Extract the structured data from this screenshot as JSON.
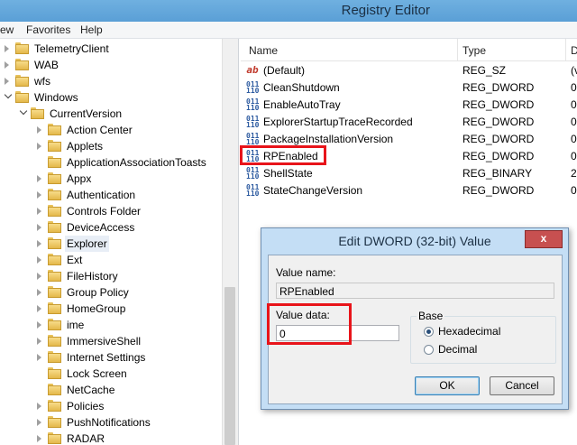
{
  "window": {
    "title": "Registry Editor"
  },
  "menu": [
    "ew",
    "Favorites",
    "Help"
  ],
  "tree": [
    {
      "label": "TelemetryClient",
      "level": 0,
      "state": "closed"
    },
    {
      "label": "WAB",
      "level": 0,
      "state": "closed"
    },
    {
      "label": "wfs",
      "level": 0,
      "state": "closed"
    },
    {
      "label": "Windows",
      "level": 0,
      "state": "open"
    },
    {
      "label": "CurrentVersion",
      "level": 1,
      "state": "open"
    },
    {
      "label": "Action Center",
      "level": 2,
      "state": "closed"
    },
    {
      "label": "Applets",
      "level": 2,
      "state": "closed"
    },
    {
      "label": "ApplicationAssociationToasts",
      "level": 2,
      "state": "none"
    },
    {
      "label": "Appx",
      "level": 2,
      "state": "closed"
    },
    {
      "label": "Authentication",
      "level": 2,
      "state": "closed"
    },
    {
      "label": "Controls Folder",
      "level": 2,
      "state": "closed"
    },
    {
      "label": "DeviceAccess",
      "level": 2,
      "state": "closed"
    },
    {
      "label": "Explorer",
      "level": 2,
      "state": "closed",
      "selected": true
    },
    {
      "label": "Ext",
      "level": 2,
      "state": "closed"
    },
    {
      "label": "FileHistory",
      "level": 2,
      "state": "closed"
    },
    {
      "label": "Group Policy",
      "level": 2,
      "state": "closed"
    },
    {
      "label": "HomeGroup",
      "level": 2,
      "state": "closed"
    },
    {
      "label": "ime",
      "level": 2,
      "state": "closed"
    },
    {
      "label": "ImmersiveShell",
      "level": 2,
      "state": "closed"
    },
    {
      "label": "Internet Settings",
      "level": 2,
      "state": "closed"
    },
    {
      "label": "Lock Screen",
      "level": 2,
      "state": "none"
    },
    {
      "label": "NetCache",
      "level": 2,
      "state": "none"
    },
    {
      "label": "Policies",
      "level": 2,
      "state": "closed"
    },
    {
      "label": "PushNotifications",
      "level": 2,
      "state": "closed"
    },
    {
      "label": "RADAR",
      "level": 2,
      "state": "closed"
    }
  ],
  "columns": {
    "name": "Name",
    "type": "Type",
    "data": "D"
  },
  "values": [
    {
      "icon": "string-value-icon",
      "name": "(Default)",
      "type": "REG_SZ",
      "data": "(v"
    },
    {
      "icon": "binary-value-icon",
      "name": "CleanShutdown",
      "type": "REG_DWORD",
      "data": "0:"
    },
    {
      "icon": "binary-value-icon",
      "name": "EnableAutoTray",
      "type": "REG_DWORD",
      "data": "0:"
    },
    {
      "icon": "binary-value-icon",
      "name": "ExplorerStartupTraceRecorded",
      "type": "REG_DWORD",
      "data": "0:"
    },
    {
      "icon": "binary-value-icon",
      "name": "PackageInstallationVersion",
      "type": "REG_DWORD",
      "data": "0:"
    },
    {
      "icon": "binary-value-icon",
      "name": "RPEnabled",
      "type": "REG_DWORD",
      "data": "0:"
    },
    {
      "icon": "binary-value-icon",
      "name": "ShellState",
      "type": "REG_BINARY",
      "data": "2"
    },
    {
      "icon": "binary-value-icon",
      "name": "StateChangeVersion",
      "type": "REG_DWORD",
      "data": "0:"
    }
  ],
  "dialog": {
    "title": "Edit DWORD (32-bit) Value",
    "close_glyph": "x",
    "value_name_label": "Value name:",
    "value_name": "RPEnabled",
    "value_data_label": "Value data:",
    "value_data": "0",
    "base_label": "Base",
    "radio_hex": "Hexadecimal",
    "radio_dec": "Decimal",
    "base_selected": "hex",
    "ok": "OK",
    "cancel": "Cancel"
  },
  "colors": {
    "highlight": "#e8141a",
    "titlebar": "#5a9fd6"
  }
}
